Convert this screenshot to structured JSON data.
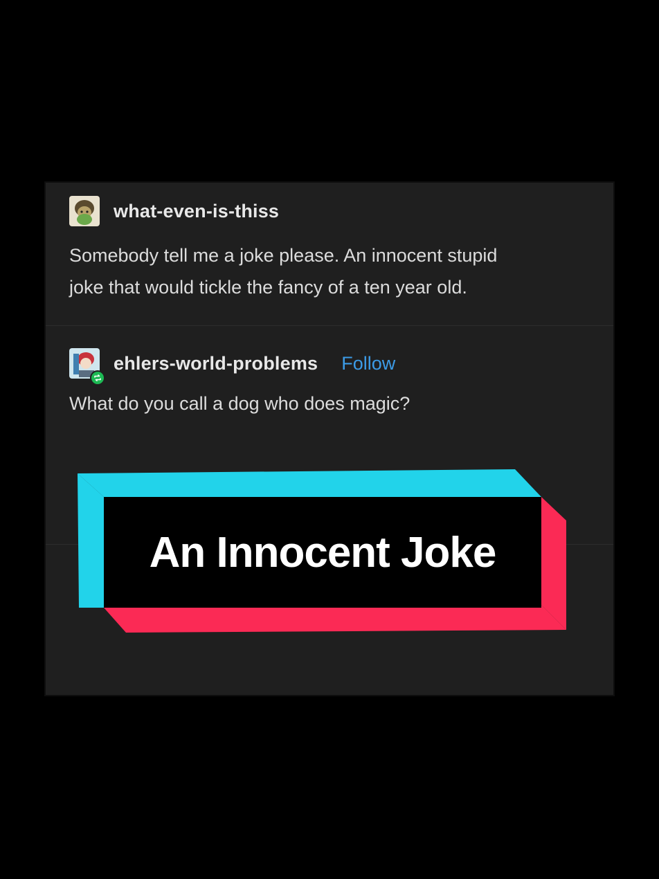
{
  "posts": [
    {
      "username": "what-even-is-thiss",
      "avatar_icon": "cartoon-avatar-icon",
      "body": "Somebody tell me a joke please. An innocent stupid\njoke that would tickle the fancy of a ten year old."
    },
    {
      "username": "ehlers-world-problems",
      "avatar_icon": "anime-avatar-icon",
      "badge_icon": "reblog-icon",
      "follow_label": "Follow",
      "body": "What do you call a dog who does magic?"
    }
  ],
  "overlay": {
    "title": "An Innocent Joke"
  },
  "colors": {
    "background": "#000000",
    "card": "#1f1f1f",
    "text": "#dcdcdc",
    "follow": "#3c9be6",
    "banner_cyan": "#22d3ea",
    "banner_pink": "#fb2a55",
    "banner_fill": "#000000",
    "reblog_badge": "#1db954"
  }
}
